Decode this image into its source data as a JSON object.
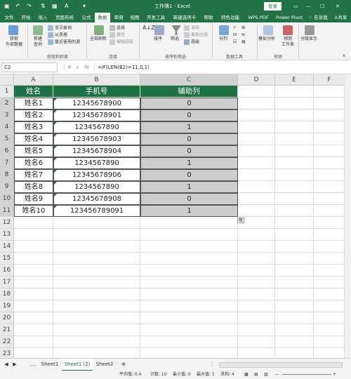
{
  "window": {
    "title": "工作簿1 - Excel",
    "login": "登录",
    "share": "共享",
    "tell_me": "告诉我",
    "user_initial": "A"
  },
  "ribbon_tabs": [
    "文件",
    "开始",
    "插入",
    "页面布局",
    "公式",
    "数据",
    "审阅",
    "视图",
    "开发工具",
    "新建选项卡",
    "帮助",
    "特色功能",
    "WPS PDF",
    "Power Pivot"
  ],
  "active_tab": "数据",
  "ribbon": {
    "get_data": "获取\n外部数据",
    "new_query": "新建\n查询",
    "show_queries": "显示查询",
    "from_table": "从表格",
    "recent_sources": "最近使用的源",
    "group_get": "获取和转换",
    "refresh_all": "全部刷新",
    "connections": "连接",
    "properties": "属性",
    "edit_links": "编辑链接",
    "group_conn": "连接",
    "sort": "排序",
    "filter": "筛选",
    "clear": "清除",
    "reapply": "重新应用",
    "advanced": "高级",
    "group_sort": "排序和筛选",
    "split": "分列",
    "group_tools": "数据工具",
    "whatif": "模拟分析",
    "forecast_sheet": "预测\n工作表",
    "group_forecast": "预测",
    "outline": "分级显示"
  },
  "formula_bar": {
    "namebox": "C2",
    "formula": "=IF(LEN(B2)=11,0,1)"
  },
  "columns": [
    "A",
    "B",
    "C",
    "D",
    "E",
    "F"
  ],
  "rows": [
    "1",
    "2",
    "3",
    "4",
    "5",
    "6",
    "7",
    "8",
    "9",
    "10",
    "11",
    "12",
    "13",
    "14",
    "15",
    "16",
    "17",
    "18",
    "19",
    "20",
    "21",
    "22",
    "23"
  ],
  "table": {
    "header": [
      "姓名",
      "手机号",
      "辅助列"
    ],
    "data": [
      [
        "姓名1",
        "12345678900",
        "0"
      ],
      [
        "姓名2",
        "12345678901",
        "0"
      ],
      [
        "姓名3",
        "1234567890",
        "1"
      ],
      [
        "姓名4",
        "12345678903",
        "0"
      ],
      [
        "姓名5",
        "12345678904",
        "0"
      ],
      [
        "姓名6",
        "1234567890",
        "1"
      ],
      [
        "姓名7",
        "12345678906",
        "0"
      ],
      [
        "姓名8",
        "1234567890",
        "1"
      ],
      [
        "姓名9",
        "12345678908",
        "0"
      ],
      [
        "姓名10",
        "123456789091",
        "1"
      ]
    ]
  },
  "sheets": [
    "Sheet1",
    "Sheet1 (2)",
    "Sheet2"
  ],
  "active_sheet": "Sheet1 (2)",
  "status": {
    "avg": "平均值: 0.4",
    "count": "计数: 10",
    "min": "最小值: 0",
    "max": "最大值: 1",
    "sum": "求和: 4"
  },
  "colors": {
    "excel_green": "#217346",
    "header_fill": "#1e7145",
    "helper_fill": "#cdcdcd"
  }
}
